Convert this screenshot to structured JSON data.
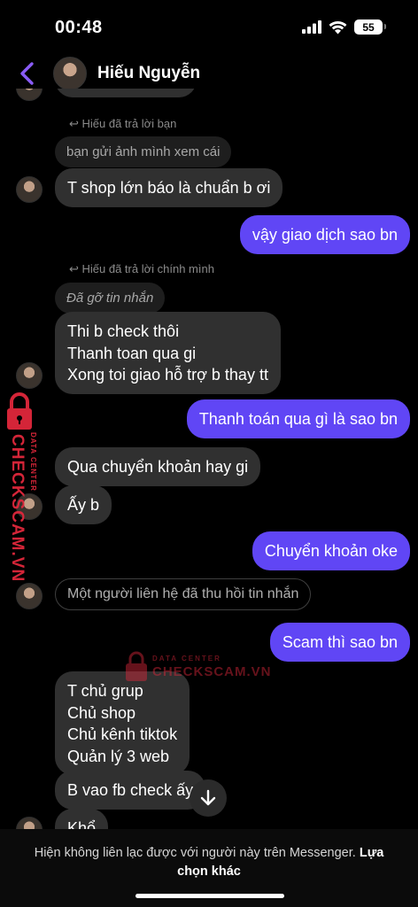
{
  "status": {
    "time": "00:48",
    "battery": "55"
  },
  "header": {
    "name": "Hiếu Nguyễn"
  },
  "messages": {
    "reply_note_1": "Hiếu đã trả lời bạn",
    "quoted_1": "bạn gửi ảnh mình xem cái",
    "m1": "T shop lớn báo là chuẩn b ơi",
    "m2": "vậy giao dịch sao bn",
    "reply_note_2": "Hiếu đã trả lời chính mình",
    "quoted_2": "Đã gỡ tin nhắn",
    "m3_lines": [
      "Thi b check thôi",
      "Thanh toan qua gi",
      "Xong toi giao hỗ trợ b thay tt"
    ],
    "m4": "Thanh toán qua gì là sao bn",
    "m5": "Qua chuyển khoản hay gi",
    "m6": "Ấy b",
    "m7": "Chuyển khoản oke",
    "unsent_notice": "Một người liên hệ đã thu hồi tin nhắn",
    "m8": "Scam thì sao bn",
    "m9_lines": [
      "T chủ grup",
      "Chủ shop",
      "Chủ kênh tiktok",
      "Quản lý 3 web"
    ],
    "m10": "B vao fb check ấy",
    "m11": "Khổ"
  },
  "watermark": {
    "brand": "CHECKSCAM.VN",
    "sub": "DATA CENTER"
  },
  "footer": {
    "notice": "Hiện không liên lạc được với người này trên Messenger.",
    "link": "Lựa chọn khác"
  },
  "colors": {
    "outgoing": "#6046f5",
    "incoming": "#303030",
    "accent": "#8a5cf6",
    "watermark": "#e0283c"
  },
  "icons": {
    "back": "chevron-left-icon",
    "scroll": "arrow-down-icon",
    "signal": "signal-icon",
    "wifi": "wifi-icon"
  }
}
